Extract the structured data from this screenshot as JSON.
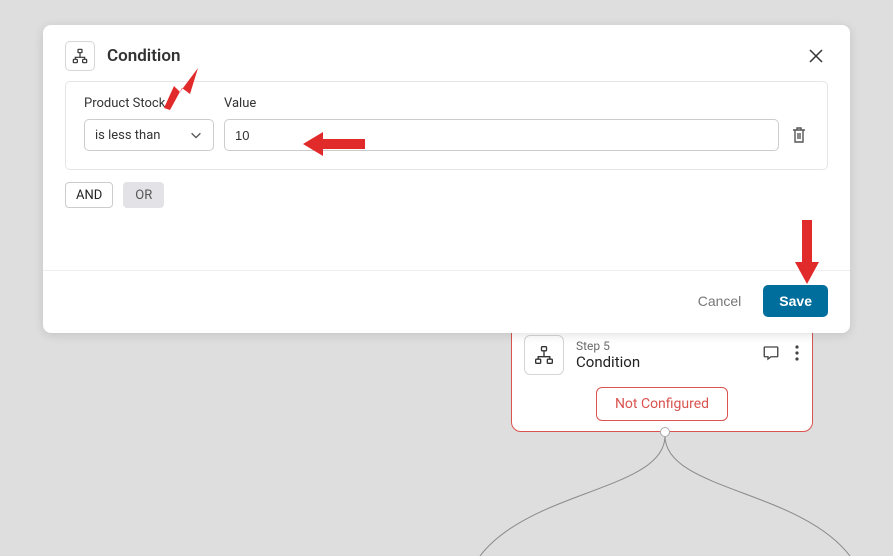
{
  "modal": {
    "title": "Condition",
    "labels": {
      "stock": "Product Stock",
      "value": "Value"
    },
    "operator_selected": "is less than",
    "value_input": "10",
    "and_label": "AND",
    "or_label": "OR",
    "cancel_label": "Cancel",
    "save_label": "Save"
  },
  "flow": {
    "step_label": "Step 5",
    "title": "Condition",
    "badge": "Not Configured"
  }
}
